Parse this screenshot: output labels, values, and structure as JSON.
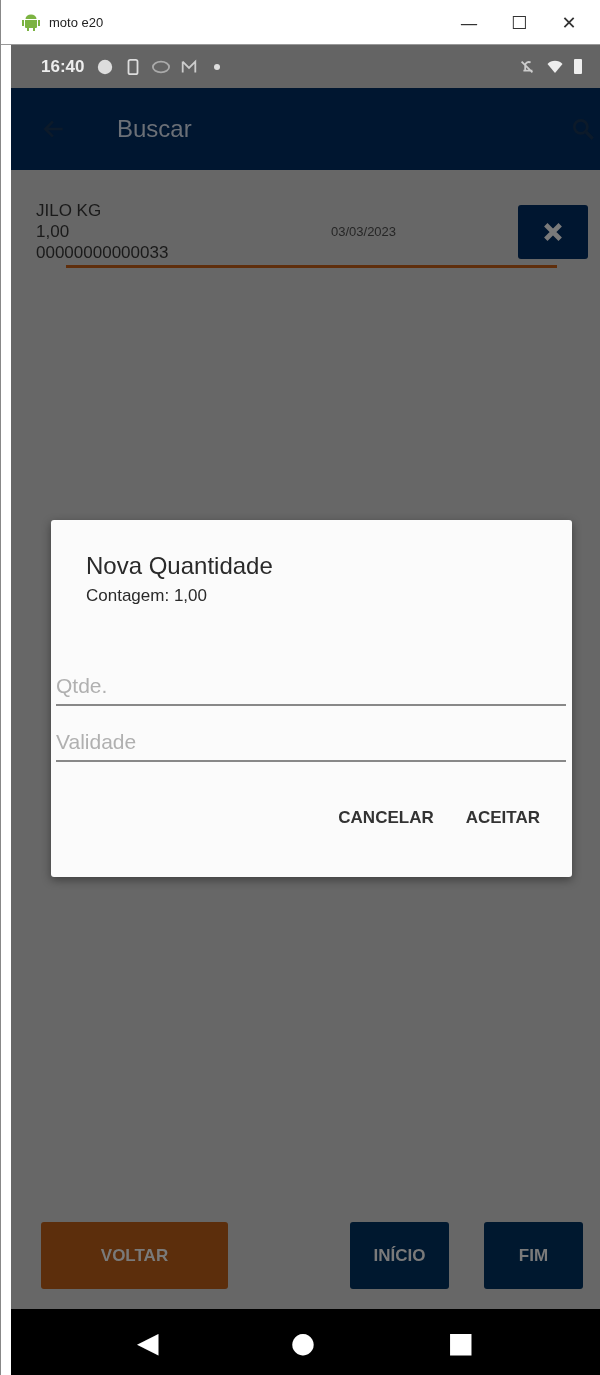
{
  "window": {
    "title": "moto e20",
    "controls": [
      "—",
      "☐",
      "✕"
    ]
  },
  "status_bar": {
    "time": "16:40"
  },
  "app_bar": {
    "title": "Buscar"
  },
  "items": [
    {
      "name": "JILO KG",
      "quantity": "1,00",
      "date": "03/03/2023",
      "code": "00000000000033"
    }
  ],
  "dialog": {
    "title": "Nova Quantidade",
    "subtitle": "Contagem: 1,00",
    "fields": [
      {
        "placeholder": "Qtde."
      },
      {
        "placeholder": "Validade"
      }
    ],
    "buttons": [
      "CANCELAR",
      "ACEITAR"
    ]
  },
  "bottom_buttons": [
    {
      "label": "VOLTAR",
      "kind": "secondary"
    },
    {
      "label": "INÍCIO",
      "kind": "primary"
    },
    {
      "label": "FIM",
      "kind": "primary"
    }
  ],
  "nav_bar": {
    "back": "◀",
    "home": "●",
    "recents": "■"
  }
}
